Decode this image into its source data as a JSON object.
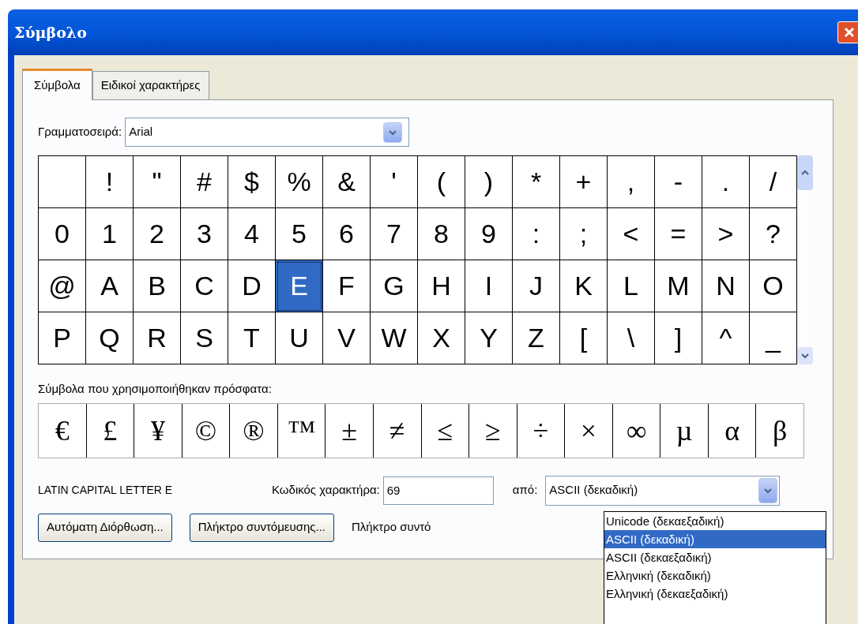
{
  "window": {
    "title": "Σύμβολο"
  },
  "tabs": [
    {
      "label": "Σύμβολα",
      "selected": true
    },
    {
      "label": "Ειδικοί χαρακτήρες",
      "selected": false
    }
  ],
  "font": {
    "label": "Γραμματοσειρά:",
    "value": "Arial"
  },
  "grid": {
    "rows": [
      [
        {},
        {
          "char": "!",
          "selected": false
        },
        {
          "char": "\"",
          "selected": false
        },
        {
          "char": "#",
          "selected": false
        },
        {
          "char": "$",
          "selected": false
        },
        {
          "char": "%",
          "selected": false
        },
        {
          "char": "&",
          "selected": false
        },
        {
          "char": "'",
          "selected": false
        },
        {
          "char": "(",
          "selected": false
        },
        {
          "char": ")",
          "selected": false
        },
        {
          "char": "*",
          "selected": false
        },
        {
          "char": "+",
          "selected": false
        },
        {
          "char": ",",
          "selected": false
        },
        {
          "char": "-",
          "selected": false
        },
        {
          "char": ".",
          "selected": false
        },
        {
          "char": "/",
          "selected": false
        }
      ],
      [
        {
          "char": "0",
          "selected": false
        },
        {
          "char": "1",
          "selected": false
        },
        {
          "char": "2",
          "selected": false
        },
        {
          "char": "3",
          "selected": false
        },
        {
          "char": "4",
          "selected": false
        },
        {
          "char": "5",
          "selected": false
        },
        {
          "char": "6",
          "selected": false
        },
        {
          "char": "7",
          "selected": false
        },
        {
          "char": "8",
          "selected": false
        },
        {
          "char": "9",
          "selected": false
        },
        {
          "char": ":",
          "selected": false
        },
        {
          "char": ";",
          "selected": false
        },
        {
          "char": "<",
          "selected": false
        },
        {
          "char": "=",
          "selected": false
        },
        {
          "char": ">",
          "selected": false
        },
        {
          "char": "?",
          "selected": false
        }
      ],
      [
        {
          "char": "@",
          "selected": false
        },
        {
          "char": "A",
          "selected": false
        },
        {
          "char": "B",
          "selected": false
        },
        {
          "char": "C",
          "selected": false
        },
        {
          "char": "D",
          "selected": false
        },
        {
          "char": "E",
          "selected": true
        },
        {
          "char": "F",
          "selected": false
        },
        {
          "char": "G",
          "selected": false
        },
        {
          "char": "H",
          "selected": false
        },
        {
          "char": "I",
          "selected": false
        },
        {
          "char": "J",
          "selected": false
        },
        {
          "char": "K",
          "selected": false
        },
        {
          "char": "L",
          "selected": false
        },
        {
          "char": "M",
          "selected": false
        },
        {
          "char": "N",
          "selected": false
        },
        {
          "char": "O",
          "selected": false
        }
      ],
      [
        {
          "char": "P",
          "selected": false
        },
        {
          "char": "Q",
          "selected": false
        },
        {
          "char": "R",
          "selected": false
        },
        {
          "char": "S",
          "selected": false
        },
        {
          "char": "T",
          "selected": false
        },
        {
          "char": "U",
          "selected": false
        },
        {
          "char": "V",
          "selected": false
        },
        {
          "char": "W",
          "selected": false
        },
        {
          "char": "X",
          "selected": false
        },
        {
          "char": "Y",
          "selected": false
        },
        {
          "char": "Z",
          "selected": false
        },
        {
          "char": "[",
          "selected": false
        },
        {
          "char": "\\",
          "selected": false
        },
        {
          "char": "]",
          "selected": false
        },
        {
          "char": "^",
          "selected": false
        },
        {
          "char": "_",
          "selected": false
        }
      ]
    ]
  },
  "recent": {
    "label": "Σύμβολα που χρησιμοποιήθηκαν πρόσφατα:",
    "symbols": [
      "€",
      "£",
      "¥",
      "©",
      "®",
      "™",
      "±",
      "≠",
      "≤",
      "≥",
      "÷",
      "×",
      "∞",
      "µ",
      "α",
      "β"
    ]
  },
  "character_name": "LATIN CAPITAL LETTER E",
  "code": {
    "label": "Κωδικός χαρακτήρα:",
    "value": "69"
  },
  "from": {
    "label": "από:",
    "value": "ASCII (δεκαδική)",
    "options": [
      {
        "label": "Unicode (δεκαεξαδική)",
        "selected": false
      },
      {
        "label": "ASCII (δεκαδική)",
        "selected": true
      },
      {
        "label": "ASCII (δεκαεξαδική)",
        "selected": false
      },
      {
        "label": "Ελληνική (δεκαδική)",
        "selected": false
      },
      {
        "label": "Ελληνική (δεκαεξαδική)",
        "selected": false
      }
    ]
  },
  "buttons": [
    "Αυτόματη Διόρθωση...",
    "Πλήκτρο συντόμευσης..."
  ],
  "shortcut_label": "Πλήκτρο συντό"
}
